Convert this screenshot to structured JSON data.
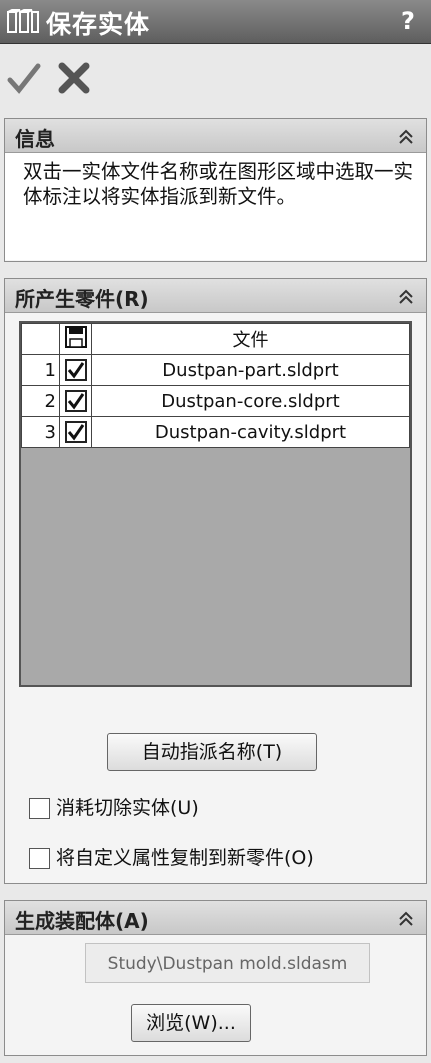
{
  "window": {
    "title": "保存实体",
    "help_label": "?"
  },
  "info_group": {
    "title": "信息",
    "message": "双击一实体文件名称或在图形区域中选取一实体标注以将实体指派到新文件。"
  },
  "parts_group": {
    "title": "所产生零件(R)",
    "table": {
      "header_file": "文件",
      "rows": [
        {
          "num": "1",
          "checked": true,
          "file": "Dustpan-part.sldprt"
        },
        {
          "num": "2",
          "checked": true,
          "file": "Dustpan-core.sldprt"
        },
        {
          "num": "3",
          "checked": true,
          "file": "Dustpan-cavity.sldprt"
        }
      ]
    },
    "auto_assign_label": "自动指派名称(T)",
    "consume_cuts_label": "消耗切除实体(U)",
    "copy_props_label": "将自定义属性复制到新零件(O)"
  },
  "assembly_group": {
    "title": "生成装配体(A)",
    "path_value": "Study\\Dustpan mold.sldasm",
    "browse_label": "浏览(W)..."
  }
}
